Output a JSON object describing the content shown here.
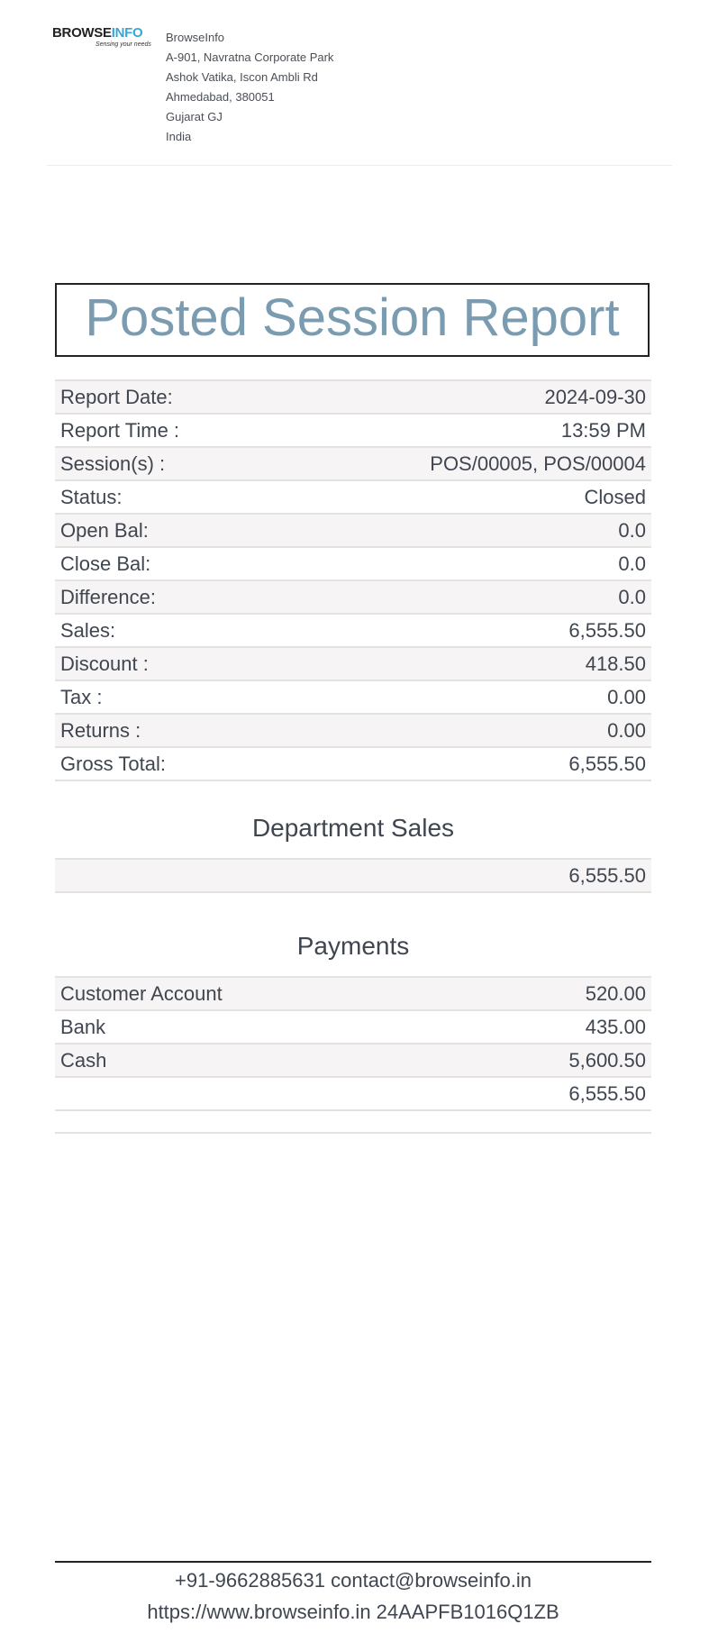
{
  "company": {
    "logo_text_1": "BROWSE",
    "logo_text_2": "INFO",
    "logo_tagline": "Sensing your needs",
    "name": "BrowseInfo",
    "address_lines": [
      "A-901, Navratna Corporate Park",
      "Ashok Vatika, Iscon Ambli Rd",
      "Ahmedabad, 380051",
      "Gujarat GJ",
      "India"
    ]
  },
  "report": {
    "title": "Posted Session Report",
    "summary": [
      {
        "label": "Report Date:",
        "value": "2024-09-30"
      },
      {
        "label": "Report Time :",
        "value": "13:59 PM"
      },
      {
        "label": "Session(s) :",
        "value": "POS/00005, POS/00004"
      },
      {
        "label": "Status:",
        "value": "Closed"
      },
      {
        "label": "Open Bal:",
        "value": "0.0"
      },
      {
        "label": "Close Bal:",
        "value": "0.0"
      },
      {
        "label": "Difference:",
        "value": "0.0"
      },
      {
        "label": "Sales:",
        "value": "6,555.50"
      },
      {
        "label": "Discount :",
        "value": "418.50"
      },
      {
        "label": "Tax :",
        "value": "0.00"
      },
      {
        "label": "Returns :",
        "value": "0.00"
      },
      {
        "label": "Gross Total:",
        "value": "6,555.50"
      }
    ]
  },
  "department_sales": {
    "title": "Department Sales",
    "rows": [
      {
        "label": "",
        "value": "6,555.50"
      }
    ]
  },
  "payments": {
    "title": "Payments",
    "rows": [
      {
        "label": "Customer Account",
        "value": "520.00"
      },
      {
        "label": "Bank",
        "value": "435.00"
      },
      {
        "label": "Cash",
        "value": "5,600.50"
      },
      {
        "label": "",
        "value": "6,555.50"
      },
      {
        "label": "",
        "value": ""
      }
    ]
  },
  "footer": {
    "line1": "+91-9662885631 contact@browseinfo.in",
    "line2": "https://www.browseinfo.in 24AAPFB1016Q1ZB"
  },
  "colors": {
    "title": "#7a9bb0",
    "row_shade": "#f7f4f5",
    "logo_accent": "#39a6d6"
  }
}
